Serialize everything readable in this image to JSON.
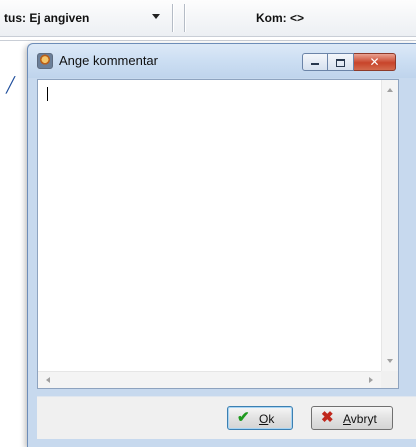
{
  "background_app": {
    "status_combo_text": "tus: Ej angiven",
    "kom_label": "Kom: <>"
  },
  "dialog": {
    "title": "Ange kommentar",
    "comment_value": "",
    "ok_accel": "O",
    "ok_rest": "k",
    "cancel_accel": "A",
    "cancel_rest": "vbryt"
  },
  "icons": {
    "dialog_icon": "app-icon",
    "minimize": "minimize-icon",
    "maximize": "maximize-icon",
    "close": "close-icon",
    "ok": "checkmark-icon",
    "cancel": "cross-icon"
  },
  "colors": {
    "title_bar": "#cddff3",
    "close_button": "#c8442a",
    "ok_check": "#1f9a1f",
    "cancel_cross": "#c0271c"
  }
}
